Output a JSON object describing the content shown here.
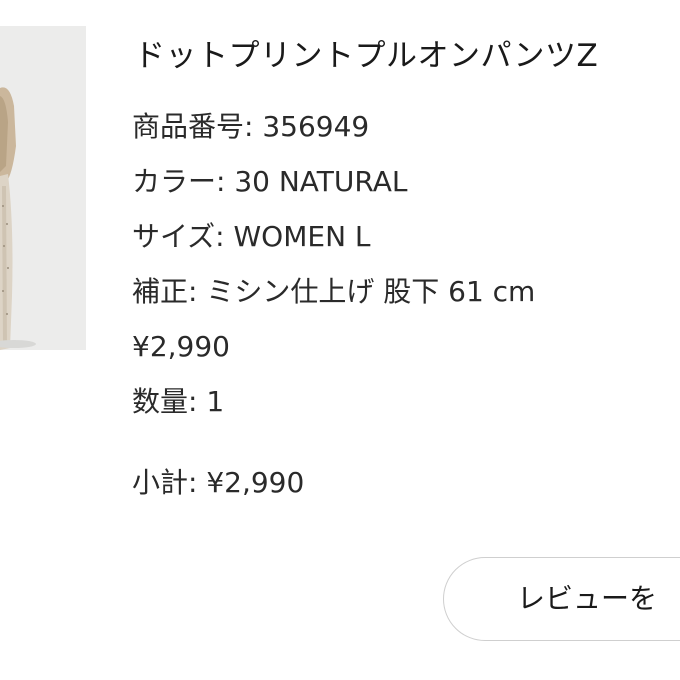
{
  "product": {
    "title": "ドットプリントプルオンパンツZ",
    "product_number": "商品番号: 356949",
    "color": "カラー: 30 NATURAL",
    "size": "サイズ: WOMEN L",
    "alteration": "補正: ミシン仕上げ 股下 61 cm",
    "price": "¥2,990",
    "quantity": "数量: 1",
    "subtotal": "小計: ¥2,990"
  },
  "actions": {
    "review_label": "レビューを"
  },
  "colors": {
    "background": "#ffffff",
    "text": "#222222",
    "button_border": "#cfcfcf",
    "thumbnail_bg": "#ececeb"
  },
  "icons": {
    "thumbnail": "product-photo"
  }
}
